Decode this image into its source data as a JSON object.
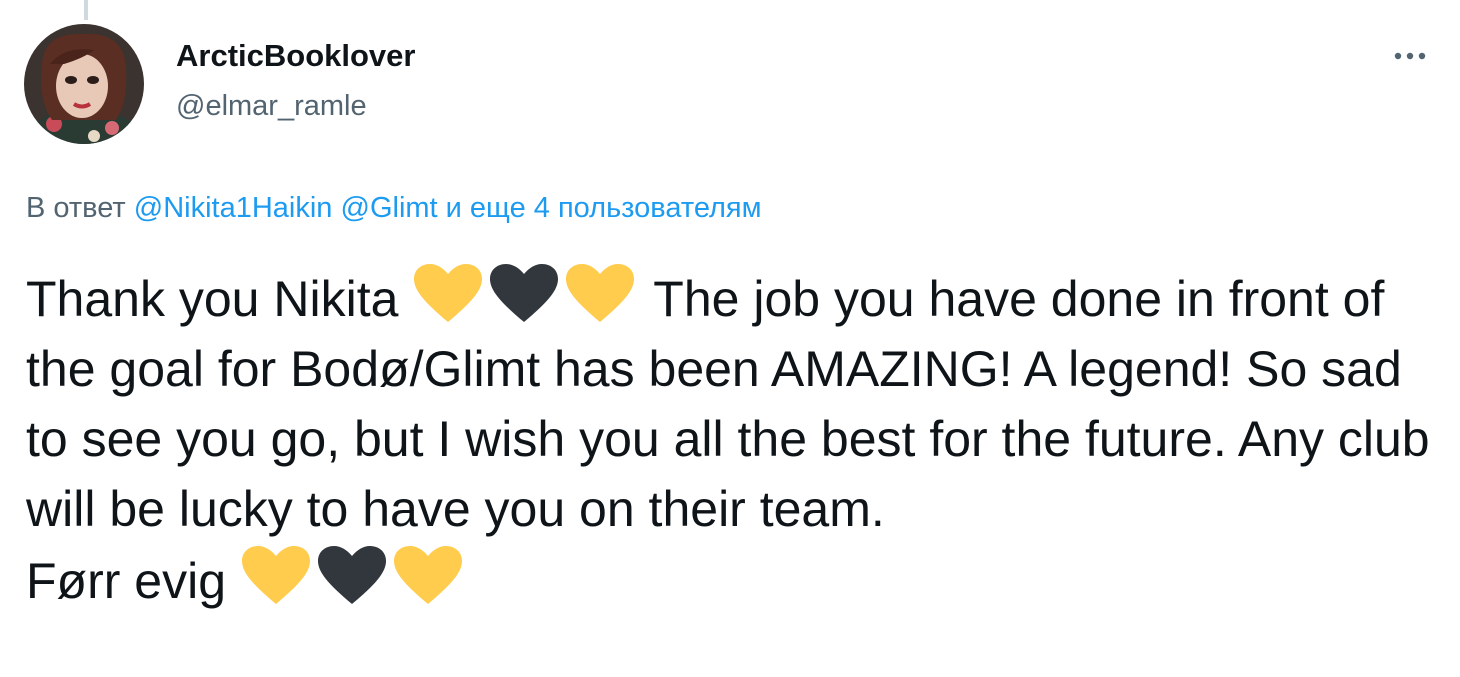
{
  "tweet": {
    "author": {
      "display_name": "ArcticBooklover",
      "handle": "@elmar_ramle"
    },
    "menu_icon": "more-horizontal-icon",
    "reply_context": {
      "prefix": "В ответ",
      "mention_1": "@Nikita1Haikin",
      "mention_2": "@Glimt",
      "others": "и еще 4 пользователям"
    },
    "text": {
      "part_1": "Thank you Nikita",
      "part_2": "The job you have done in front of the goal for Bodø/Glimt has been AMAZING! A legend! So sad to see you go, but I wish you all the best for the future. Any club will be lucky to have you on their team.",
      "part_3": "Førr evig"
    },
    "emoji": {
      "yellow_heart": "yellow-heart-icon",
      "black_heart": "black-heart-icon",
      "yellow_color": "#FFCC4D",
      "black_color": "#31373D"
    }
  }
}
